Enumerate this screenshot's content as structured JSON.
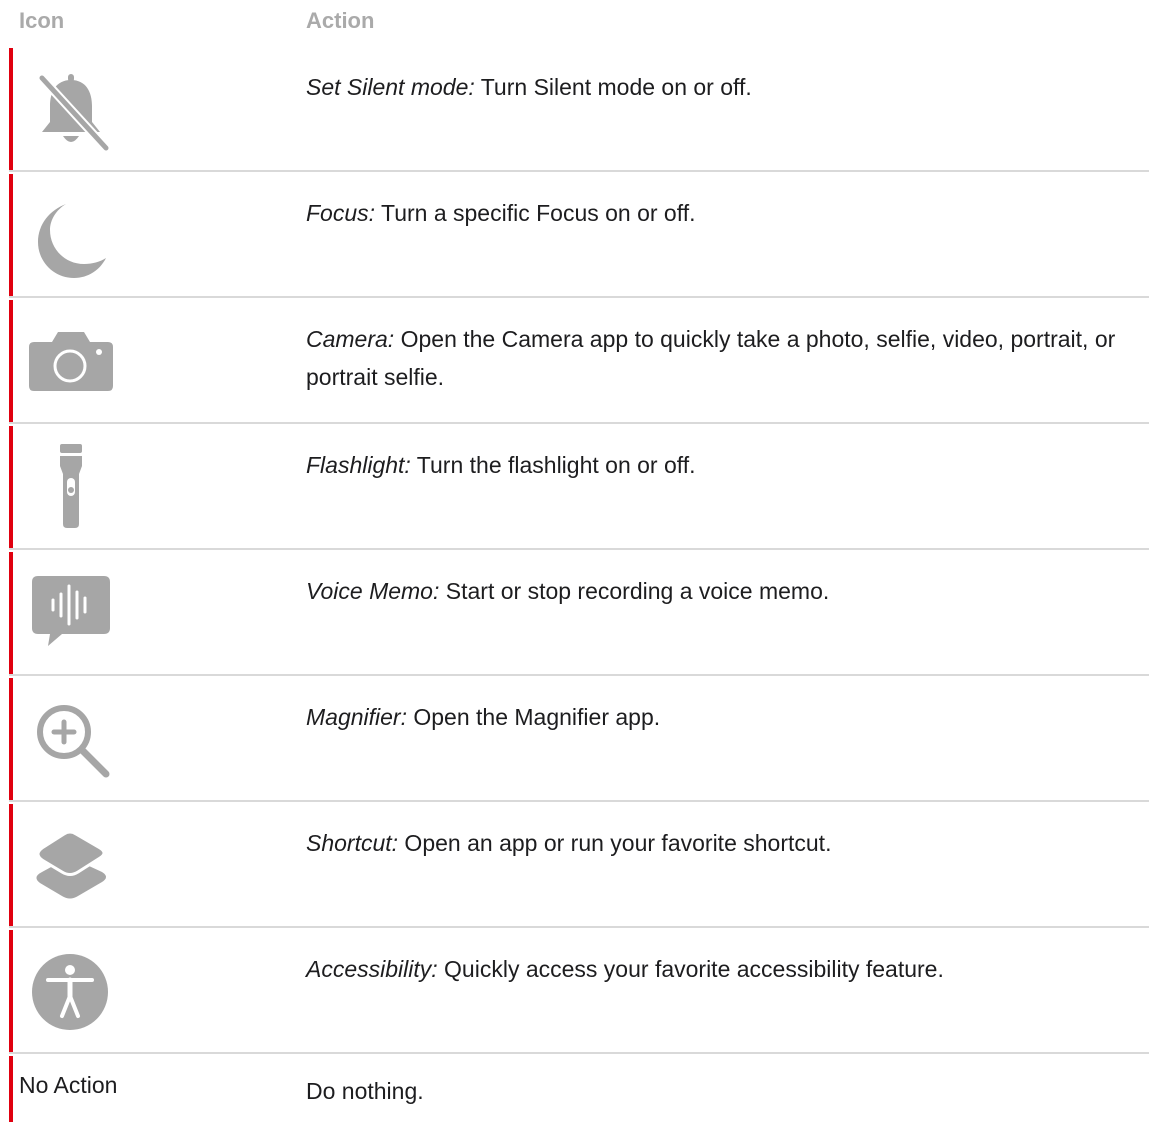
{
  "header": {
    "icon_label": "Icon",
    "action_label": "Action"
  },
  "rows": [
    {
      "icon": "silent-mode-icon",
      "term": "Set Silent mode:",
      "text": " Turn Silent mode on or off."
    },
    {
      "icon": "focus-moon-icon",
      "term": "Focus:",
      "text": " Turn a specific Focus on or off."
    },
    {
      "icon": "camera-icon",
      "term": "Camera:",
      "text": " Open the Camera app to quickly take a photo, selfie, video, portrait, or portrait selfie."
    },
    {
      "icon": "flashlight-icon",
      "term": "Flashlight:",
      "text": " Turn the flashlight on or off."
    },
    {
      "icon": "voice-memo-icon",
      "term": "Voice Memo:",
      "text": " Start or stop recording a voice memo."
    },
    {
      "icon": "magnifier-icon",
      "term": "Magnifier:",
      "text": " Open the Magnifier app."
    },
    {
      "icon": "shortcut-icon",
      "term": "Shortcut:",
      "text": " Open an app or run your favorite shortcut."
    },
    {
      "icon": "accessibility-icon",
      "term": "Accessibility:",
      "text": " Quickly access your favorite accessibility feature."
    }
  ],
  "no_action": {
    "label": "No Action",
    "text": "Do nothing."
  },
  "colors": {
    "accent_bar": "#e0000f",
    "icon_gray": "#a6a6a6",
    "header_gray": "#aaaaaa"
  }
}
